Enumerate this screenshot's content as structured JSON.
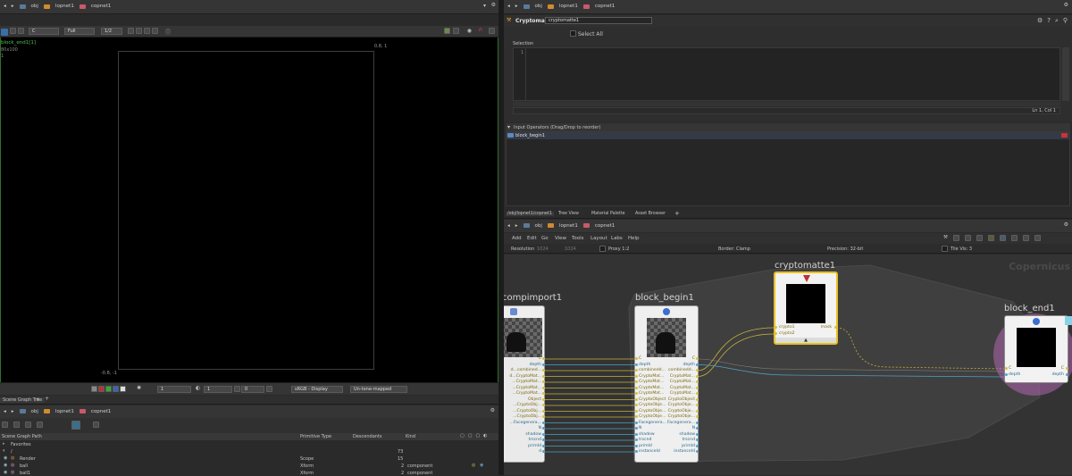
{
  "left_top_bar": {
    "path": [
      "obj",
      "lopnet1",
      "copnet1"
    ]
  },
  "viewer": {
    "node_label": "block_end1[1]",
    "resolution_label": "80x100",
    "line3": "1",
    "display_select": "C",
    "fit_select": "Full",
    "scale_select": "1/2",
    "coord_top_right": "0.8, 1",
    "coord_bottom_left": "-0.8, -1",
    "bottom": {
      "field1": "1",
      "field2": "1",
      "field3": "0",
      "colorspace": "sRGB - Display",
      "tonemap": "Un-tone-mapped"
    }
  },
  "scene_tree": {
    "tab": "Scene Graph Tree",
    "path": [
      "obj",
      "lopnet1",
      "copnet1"
    ],
    "columns": [
      "Scene Graph Path",
      "Primitive Type",
      "Descendants",
      "Kind"
    ],
    "rows": [
      {
        "name": "Favorites",
        "type": "",
        "desc": "",
        "kind": ""
      },
      {
        "name": "/",
        "type": "",
        "desc": "73",
        "kind": ""
      },
      {
        "name": "Render",
        "type": "Scope",
        "desc": "15",
        "kind": ""
      },
      {
        "name": "ball",
        "type": "Xform",
        "desc": "2",
        "kind": "component"
      },
      {
        "name": "ball1",
        "type": "Xform",
        "desc": "2",
        "kind": "component"
      }
    ]
  },
  "right_top_bar": {
    "path": [
      "obj",
      "lopnet1",
      "copnet1"
    ]
  },
  "params": {
    "node_type": "Cryptomatte",
    "node_name": "cryptomatte1",
    "select_all": "Select All",
    "selection_label": "Selection",
    "line_number": "1",
    "status": "Ln 1, Col 1",
    "input_header": "Input Operators (Drag/Drop to reorder)",
    "inputs": [
      "block_begin1"
    ]
  },
  "network": {
    "tabs": [
      "/obj/lopnet1/copnet1",
      "Tree View",
      "Material Palette",
      "Asset Browser"
    ],
    "path": [
      "obj",
      "lopnet1",
      "copnet1"
    ],
    "menu": [
      "Add",
      "Edit",
      "Go",
      "View",
      "Tools",
      "Layout",
      "Labs",
      "Help"
    ],
    "info": {
      "resolution": "Resolution",
      "res_val": "1024",
      "res_val2": "1024",
      "proxy": "Proxy 1:2",
      "border": "Border: Clamp",
      "precision": "Precision: 32-bit",
      "tile": "Tile Vis: 3"
    },
    "watermark": "Copernicus",
    "nodes": {
      "compimport": {
        "title": "compimport1"
      },
      "block_begin": {
        "title": "block_begin1",
        "in_ports": [
          "C",
          "depth",
          "combinedd...",
          "CryptoMat...",
          "CryptoMat...",
          "CryptoMat...",
          "CryptoMat...",
          "CryptoObject",
          "CryptoObje...",
          "CryptoObje...",
          "CryptoObje...",
          "Facegenera...",
          "N",
          "shadow",
          "trscnd",
          "primId",
          "instanceId"
        ],
        "out_ports": [
          "C",
          "depth",
          "combinedd...",
          "CryptoMat...",
          "CryptoMat...",
          "CryptoMat...",
          "CryptoMat...",
          "CryptoObject",
          "CryptoObje...",
          "CryptoObje...",
          "CryptoObje...",
          "Facegenera...",
          "N",
          "shadow",
          "trscnd",
          "primId",
          "instanceId"
        ]
      },
      "compimport_ports": [
        "C",
        "depth",
        "d...combined...",
        "d...CryptoMat...",
        "...CryptoMat...",
        "...CryptoMat...",
        "...CryptoMat...",
        "Object",
        "...CryptoObj...",
        "...CryptoObj...",
        "...CryptoObj...",
        "...Facegenera...",
        "N",
        "shadow",
        "trscnd",
        "primId",
        "d"
      ],
      "cryptomatte": {
        "title": "cryptomatte1",
        "inputs": [
          "crypto1",
          "crypto2"
        ],
        "output": "mask"
      },
      "block_end": {
        "title": "block_end1",
        "inputs": [
          "C",
          "depth"
        ],
        "outputs": [
          "C",
          "depth"
        ]
      }
    }
  }
}
